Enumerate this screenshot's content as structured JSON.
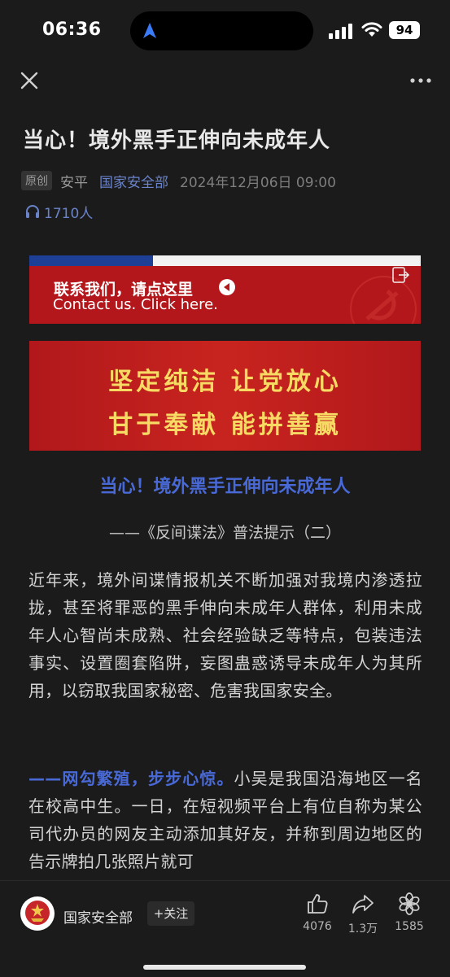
{
  "status_bar": {
    "time": "06:36",
    "battery": "94"
  },
  "article": {
    "title": "当心！境外黑手正伸向未成年人",
    "badge": "原创",
    "author": "安平",
    "source": "国家安全部",
    "date": "2024年12月06日 09:00",
    "listen_count": "1710人"
  },
  "banner_contact": {
    "cn": "联系我们，请点这里",
    "en": "Contact us. Click here."
  },
  "banner_slogan": {
    "line1": "坚定纯洁 让党放心",
    "line2": "甘于奉献 能拼善赢"
  },
  "body": {
    "subtitle": "当心！境外黑手正伸向未成年人",
    "hint": "——《反间谍法》普法提示（二）",
    "para1": "近年来，境外间谍情报机关不断加强对我境内渗透拉拢，甚至将罪恶的黑手伸向未成年人群体，利用未成年人心智尚未成熟、社会经验缺乏等特点，包装违法事实、设置圈套陷阱，妄图蛊惑诱导未成年人为其所用，以窃取我国家秘密、危害我国家安全。",
    "para2_highlight": "——网勾繁殖，步步心惊。",
    "para2_text": "小吴是我国沿海地区一名在校高中生。一日，在短视频平台上有位自称为某公司代办员的网友主动添加其好友，并称到周边地区的告示牌拍几张照片就可"
  },
  "bottom_bar": {
    "account_name": "国家安全部",
    "follow_label": "+关注",
    "like_count": "4076",
    "share_count": "1.3万",
    "recommend_count": "1585"
  },
  "icons": {
    "close": "close-icon",
    "more": "more-dots-icon",
    "headphones": "headphones-icon",
    "like": "thumbs-up-icon",
    "share": "share-arrow-icon",
    "recommend": "flower-icon"
  },
  "colors": {
    "background": "#1b1b1b",
    "link_blue": "#4869d6",
    "banner_red": "#b3171b",
    "slogan_gold": "#f7da63"
  }
}
